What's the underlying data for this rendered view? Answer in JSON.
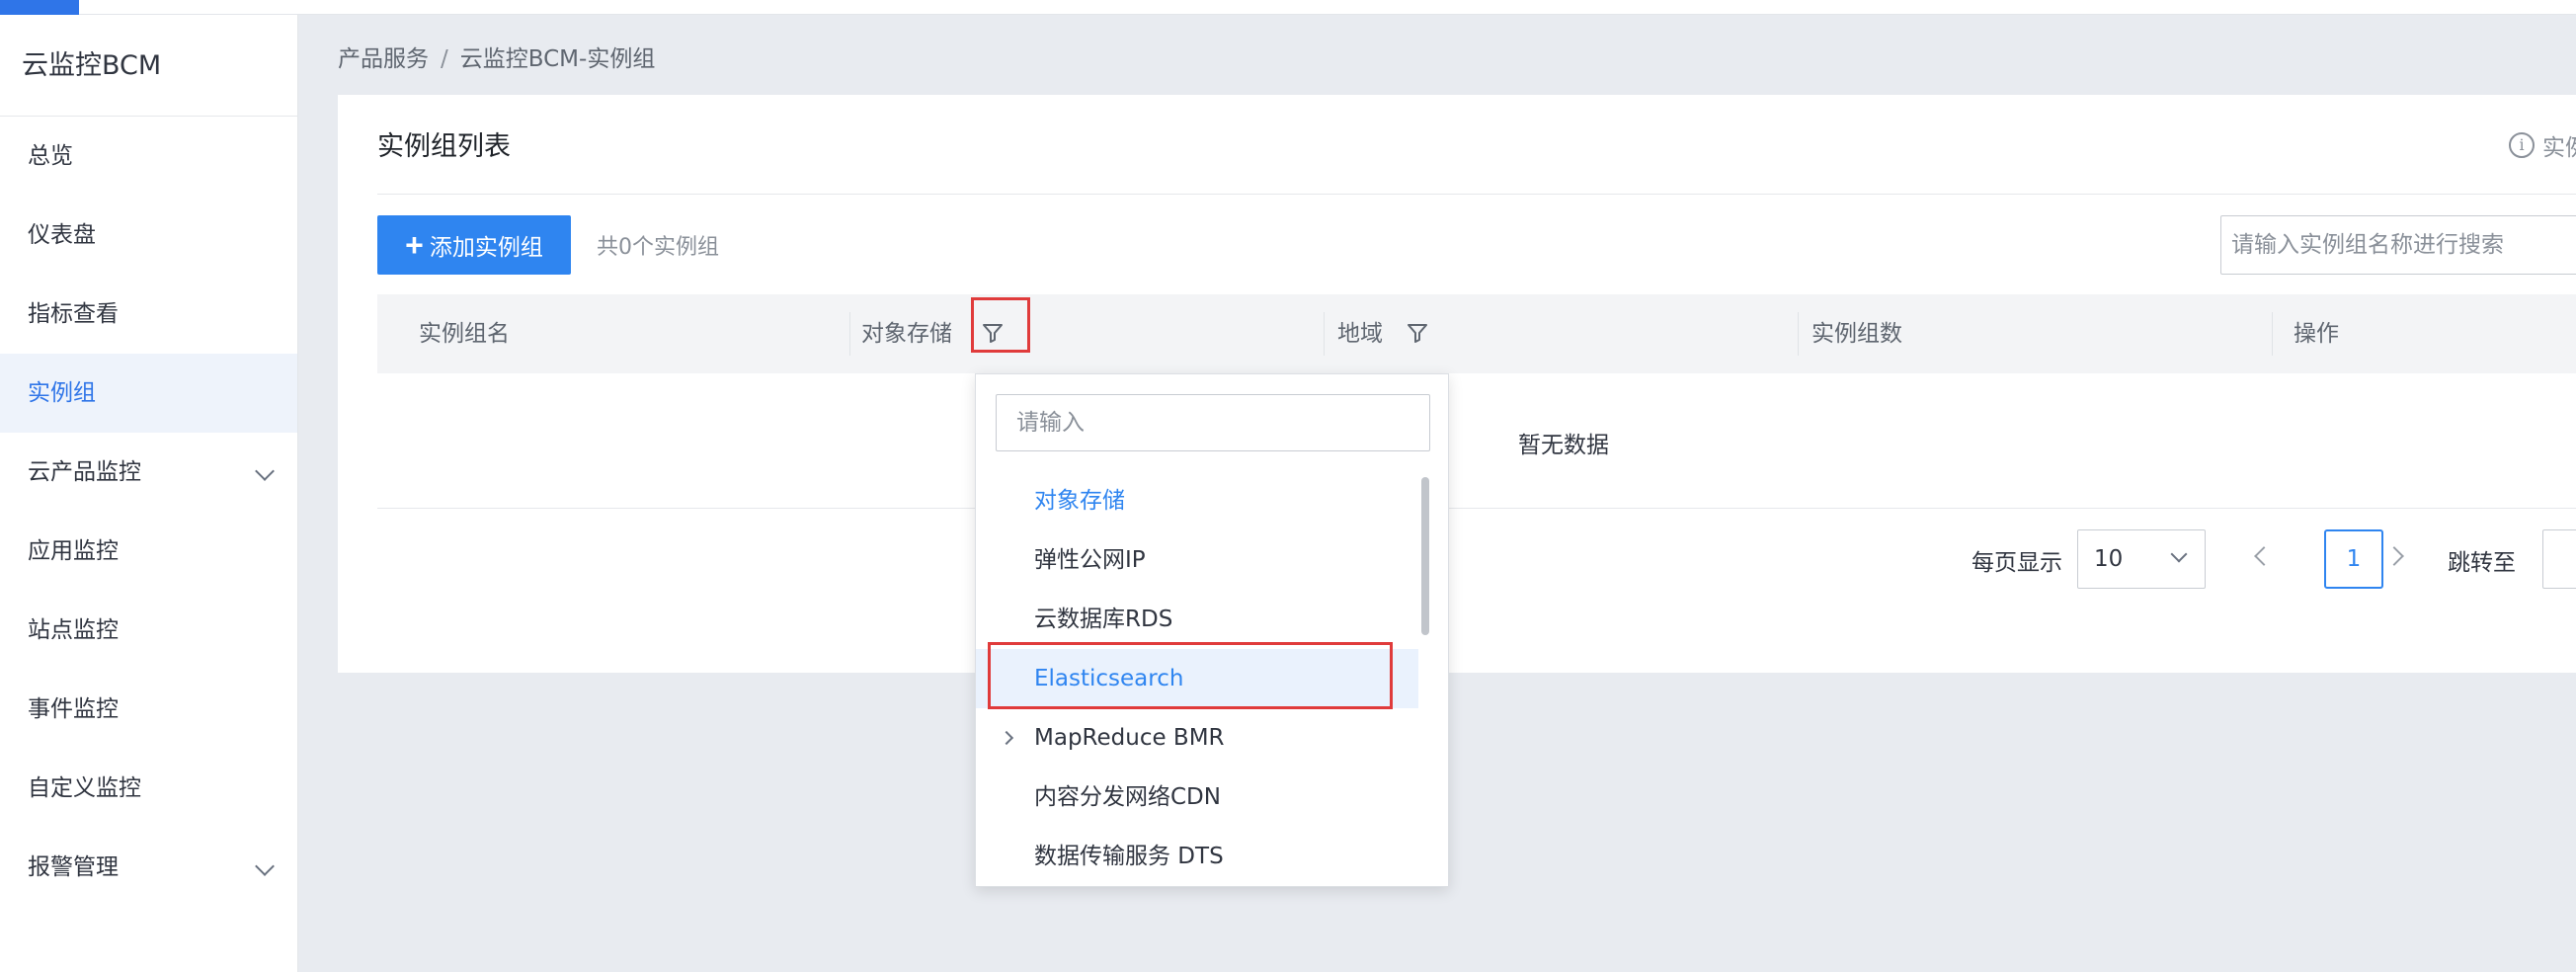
{
  "sidebar": {
    "brand": "云监控BCM",
    "items": [
      {
        "label": "总览"
      },
      {
        "label": "仪表盘"
      },
      {
        "label": "指标查看"
      },
      {
        "label": "实例组"
      },
      {
        "label": "云产品监控"
      },
      {
        "label": "应用监控"
      },
      {
        "label": "站点监控"
      },
      {
        "label": "事件监控"
      },
      {
        "label": "自定义监控"
      },
      {
        "label": "报警管理"
      }
    ]
  },
  "breadcrumb": {
    "parent": "产品服务",
    "separator": "/",
    "current": "云监控BCM-实例组"
  },
  "card": {
    "title": "实例组列表",
    "hint": "实例",
    "add_button": "添加实例组",
    "count_text": "共0个实例组",
    "search_placeholder": "请输入实例组名称进行搜索"
  },
  "table": {
    "columns": [
      "实例组名",
      "对象存储",
      "地域",
      "实例组数",
      "操作"
    ],
    "empty_text": "暂无数据"
  },
  "pagination": {
    "page_size_label": "每页显示",
    "page_size": "10",
    "current_page": "1",
    "jump_label": "跳转至"
  },
  "dropdown": {
    "search_placeholder": "请输入",
    "options": [
      {
        "label": "对象存储"
      },
      {
        "label": "弹性公网IP"
      },
      {
        "label": "云数据库RDS"
      },
      {
        "label": "Elasticsearch"
      },
      {
        "label": "MapReduce BMR"
      },
      {
        "label": "内容分发网络CDN"
      },
      {
        "label": "数据传输服务 DTS"
      }
    ]
  },
  "colors": {
    "accent": "#2f85f0",
    "highlight": "#e03b3b"
  }
}
